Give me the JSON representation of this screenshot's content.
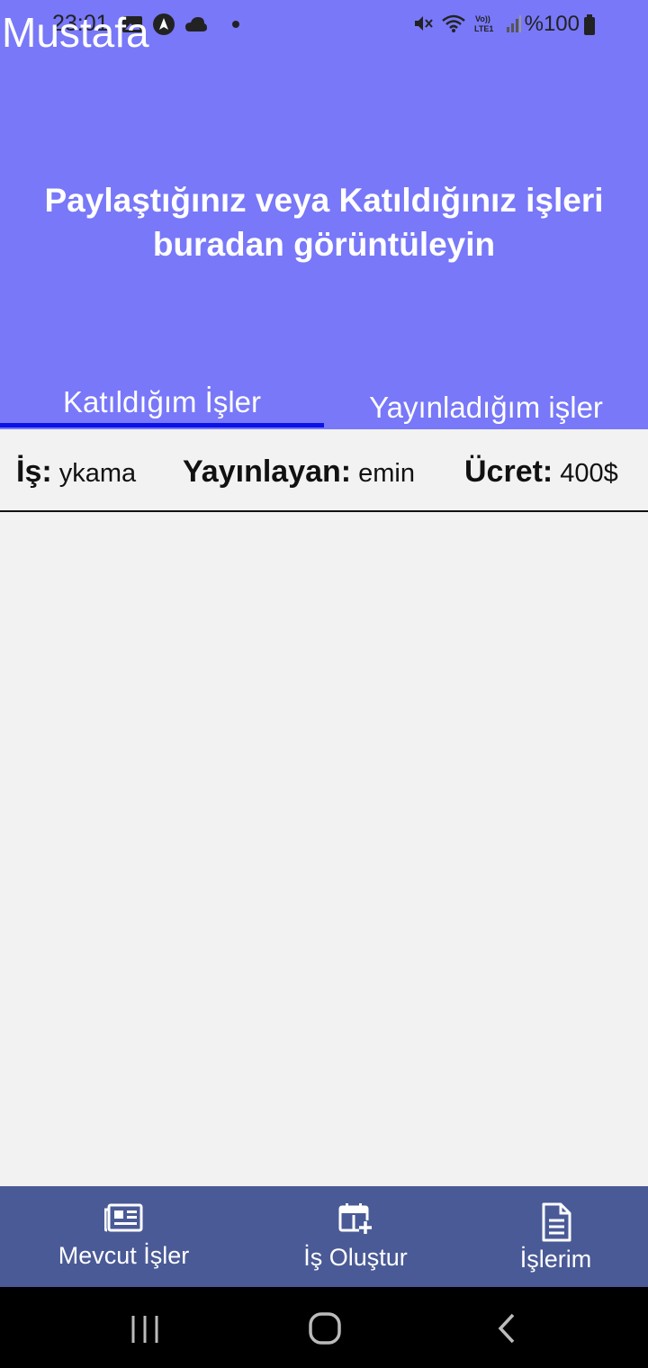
{
  "status_bar": {
    "time": "23:01",
    "battery": "%100",
    "icons_left": [
      "image-icon",
      "navigation-icon",
      "cloud-icon",
      "dot-icon"
    ],
    "icons_right": [
      "mute-icon",
      "wifi-icon",
      "volte-lte-icon",
      "signal-icon",
      "battery-icon"
    ]
  },
  "header": {
    "user_name": "Mustafa",
    "headline_line1": "Paylaştığınız veya Katıldığınız işleri",
    "headline_line2": "buradan görüntüleyin",
    "background_color": "#7878f9"
  },
  "tabs": [
    {
      "label": "Katıldığım İşler",
      "active": true
    },
    {
      "label": "Yayınladığım işler",
      "active": false
    }
  ],
  "jobs": [
    {
      "job_label": "İş:",
      "job_value": "ykama",
      "publisher_label": "Yayınlayan:",
      "publisher_value": "emin",
      "fee_label": "Ücret:",
      "fee_value": "400$"
    }
  ],
  "bottom_nav": {
    "items": [
      {
        "label": "Mevcut İşler",
        "icon": "newspaper-icon"
      },
      {
        "label": "İş Oluştur",
        "icon": "add-calendar-icon"
      },
      {
        "label": "İşlerim",
        "icon": "document-icon"
      }
    ],
    "background_color": "#4a5a96"
  },
  "system_nav": {
    "buttons": [
      "recent-apps-icon",
      "home-icon",
      "back-icon"
    ]
  }
}
